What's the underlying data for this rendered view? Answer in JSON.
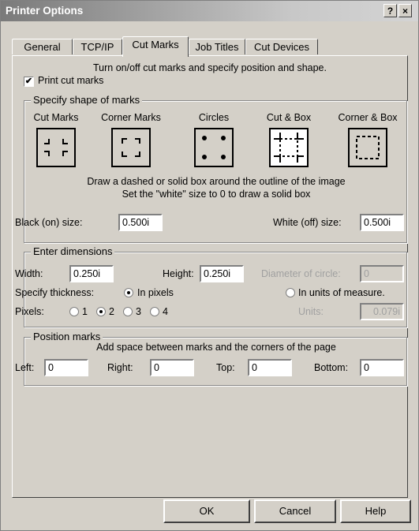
{
  "window": {
    "title": "Printer Options",
    "help_glyph": "?",
    "close_glyph": "×"
  },
  "tabs": [
    {
      "label": "General",
      "active": false
    },
    {
      "label": "TCP/IP",
      "active": false
    },
    {
      "label": "Cut Marks",
      "active": true
    },
    {
      "label": "Job Titles",
      "active": false
    },
    {
      "label": "Cut Devices",
      "active": false
    }
  ],
  "intro": "Turn on/off cut marks and specify position and shape.",
  "print_cut_marks": {
    "label": "Print cut marks",
    "checked": true,
    "mark": "✔"
  },
  "shape_group": {
    "legend": "Specify shape of marks",
    "options": [
      "Cut Marks",
      "Corner Marks",
      "Circles",
      "Cut & Box",
      "Corner & Box"
    ],
    "selected": "Cut & Box",
    "note1": "Draw a dashed or solid box around the outline of the image",
    "note2": "Set the \"white\" size to 0 to draw a solid box",
    "black_label": "Black (on) size:",
    "black_value": "0.500i",
    "white_label": "White (off) size:",
    "white_value": "0.500i"
  },
  "dimensions": {
    "legend": "Enter dimensions",
    "width_label": "Width:",
    "width_value": "0.250i",
    "height_label": "Height:",
    "height_value": "0.250i",
    "diameter_label": "Diameter of circle:",
    "diameter_value": "0",
    "thickness_label": "Specify thickness:",
    "in_pixels_label": "In pixels",
    "in_units_label": "In units of measure.",
    "thickness_mode": "In pixels",
    "pixels_label": "Pixels:",
    "pixel_options": [
      "1",
      "2",
      "3",
      "4"
    ],
    "pixel_selected": "2",
    "units_label": "Units:",
    "units_value": "0.079i"
  },
  "position": {
    "legend": "Position marks",
    "note": "Add space between marks and the corners of the page",
    "left_label": "Left:",
    "left_value": "0",
    "right_label": "Right:",
    "right_value": "0",
    "top_label": "Top:",
    "top_value": "0",
    "bottom_label": "Bottom:",
    "bottom_value": "0"
  },
  "buttons": {
    "ok": "OK",
    "cancel": "Cancel",
    "help": "Help"
  }
}
